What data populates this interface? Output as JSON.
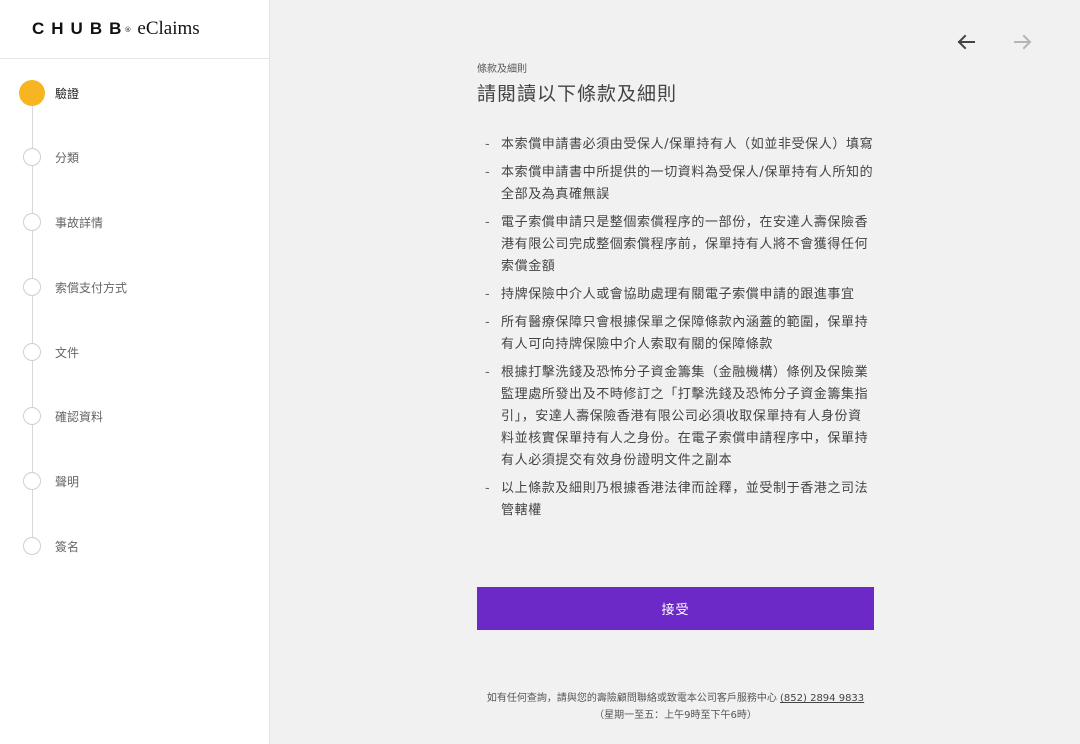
{
  "brand": {
    "name": "CHUBB",
    "registered": "®",
    "product": "eClaims"
  },
  "steps": [
    {
      "label": "驗證",
      "active": true
    },
    {
      "label": "分類",
      "active": false
    },
    {
      "label": "事故詳情",
      "active": false
    },
    {
      "label": "索償支付方式",
      "active": false
    },
    {
      "label": "文件",
      "active": false
    },
    {
      "label": "確認資料",
      "active": false
    },
    {
      "label": "聲明",
      "active": false
    },
    {
      "label": "簽名",
      "active": false
    }
  ],
  "header": {
    "overline": "條款及細則",
    "title": "請閱讀以下條款及細則"
  },
  "terms": [
    "本索償申請書必須由受保人/保單持有人（如並非受保人）填寫",
    "本索償申請書中所提供的一切資料為受保人/保單持有人所知的全部及為真確無誤",
    "電子索償申請只是整個索償程序的一部份，在安達人壽保險香港有限公司完成整個索償程序前，保單持有人將不會獲得任何索償金額",
    "持牌保險中介人或會協助處理有關電子索償申請的跟進事宜",
    "所有醫療保障只會根據保單之保障條款內涵蓋的範圍，保單持有人可向持牌保險中介人索取有關的保障條款",
    "根據打擊洗錢及恐怖分子資金籌集（金融機構）條例及保險業監理處所發出及不時修訂之「打擊洗錢及恐怖分子資金籌集指引」，安達人壽保險香港有限公司必須收取保單持有人身份資料並核實保單持有人之身份。在電子索償申請程序中，保單持有人必須提交有效身份證明文件之副本",
    "以上條款及細則乃根據香港法律而詮釋，並受制于香港之司法管轄權"
  ],
  "accept_label": "接受",
  "footer": {
    "line1_prefix": "如有任何查詢，請與您的壽險顧問聯絡或致電本公司客戶服務中心 ",
    "phone": "(852) 2894 9833",
    "line2": "（星期一至五：上午9時至下午6時）"
  },
  "nav": {
    "back_icon": "arrow-left-icon",
    "forward_icon": "arrow-right-icon"
  },
  "colors": {
    "accent": "#6d28c8",
    "active_step": "#f6b521",
    "background": "#f1f1f1"
  }
}
